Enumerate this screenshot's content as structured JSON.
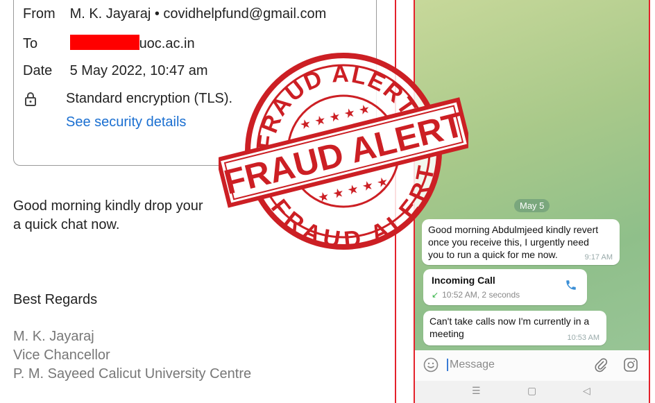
{
  "email": {
    "from_label": "From",
    "from_value": "M. K. Jayaraj • covidhelpfund@gmail.com",
    "to_label": "To",
    "to_value": "uoc.ac.in",
    "date_label": "Date",
    "date_value": "5 May 2022, 10:47 am",
    "encryption": "Standard encryption (TLS).",
    "security_link": "See security details",
    "body_line1": "Good morning kindly drop your",
    "body_line2": "a quick chat now.",
    "regards": "Best Regards",
    "sig_name": "M. K. Jayaraj",
    "sig_title": "Vice Chancellor",
    "sig_org": "P. M. Sayeed Calicut University Centre"
  },
  "stamp": {
    "text_top": "FRAUD ALERT",
    "text_middle": "FRAUD ALERT",
    "text_bottom": "FRAUD ALERT",
    "color": "#cc1f24"
  },
  "chat": {
    "date_chip": "May 5",
    "msg1_line1": "Good morning Abdulmjeed kindly revert",
    "msg1_line2": "once you receive this, I urgently need",
    "msg1_line3": "you to run a quick for me now.",
    "msg1_time": "9:17 AM",
    "call_title": "Incoming Call",
    "call_sub": "10:52 AM, 2 seconds",
    "msg3_line1": "Can't take calls now I'm currently in a",
    "msg3_line2": "meeting",
    "msg3_time": "10:53 AM",
    "input_placeholder": "Message",
    "nav_menu": "☰",
    "nav_home": "▢",
    "nav_back": "◁"
  },
  "colors": {
    "accent_red": "#e4212b",
    "link_blue": "#1a6fd1",
    "chat_bg": "#a9c98a"
  },
  "icons": [
    "lock-icon",
    "phone-icon",
    "emoji-icon",
    "attach-icon",
    "camera-icon"
  ]
}
